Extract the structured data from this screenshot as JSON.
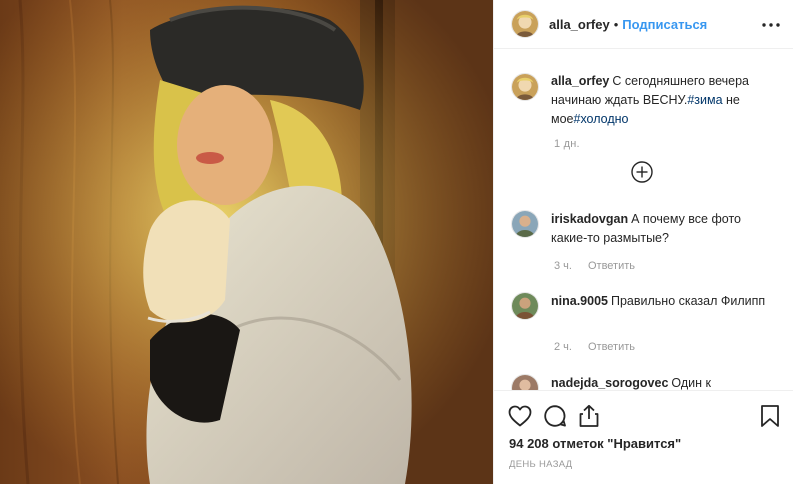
{
  "post": {
    "author": "alla_orfey",
    "separator": "•",
    "follow_label": "Подписаться"
  },
  "caption": {
    "username": "alla_orfey",
    "text_before_tag1": "С сегодняшнего вечера начинаю ждать ВЕСНУ.",
    "tag1": "#зима",
    "text_between": " не мое",
    "tag2": "#холодно",
    "time": "1 дн."
  },
  "comments": [
    {
      "username": "iriskadovgan",
      "text": "А почему все фото какие-то размытые?",
      "time": "3 ч.",
      "reply_label": "Ответить"
    },
    {
      "username": "nina.9005",
      "text": "Правильно сказал Филипп",
      "time": "2 ч.",
      "reply_label": "Ответить"
    },
    {
      "username": "nadejda_sorogovec",
      "text": "Один к",
      "time": "",
      "reply_label": ""
    }
  ],
  "likes": {
    "count_text": "94 208 отметок \"Нравится\""
  },
  "date_label": "ДЕНЬ НАЗАД",
  "icons": {
    "more": "more-horizontal-icon",
    "load_more": "plus-circle-icon",
    "like": "heart-icon",
    "comment": "comment-bubble-icon",
    "share": "share-upload-icon",
    "save": "bookmark-icon"
  },
  "colors": {
    "link_blue": "#3897f0",
    "hashtag": "#003569",
    "muted": "#999999",
    "text": "#262626",
    "divider": "#efefef"
  }
}
